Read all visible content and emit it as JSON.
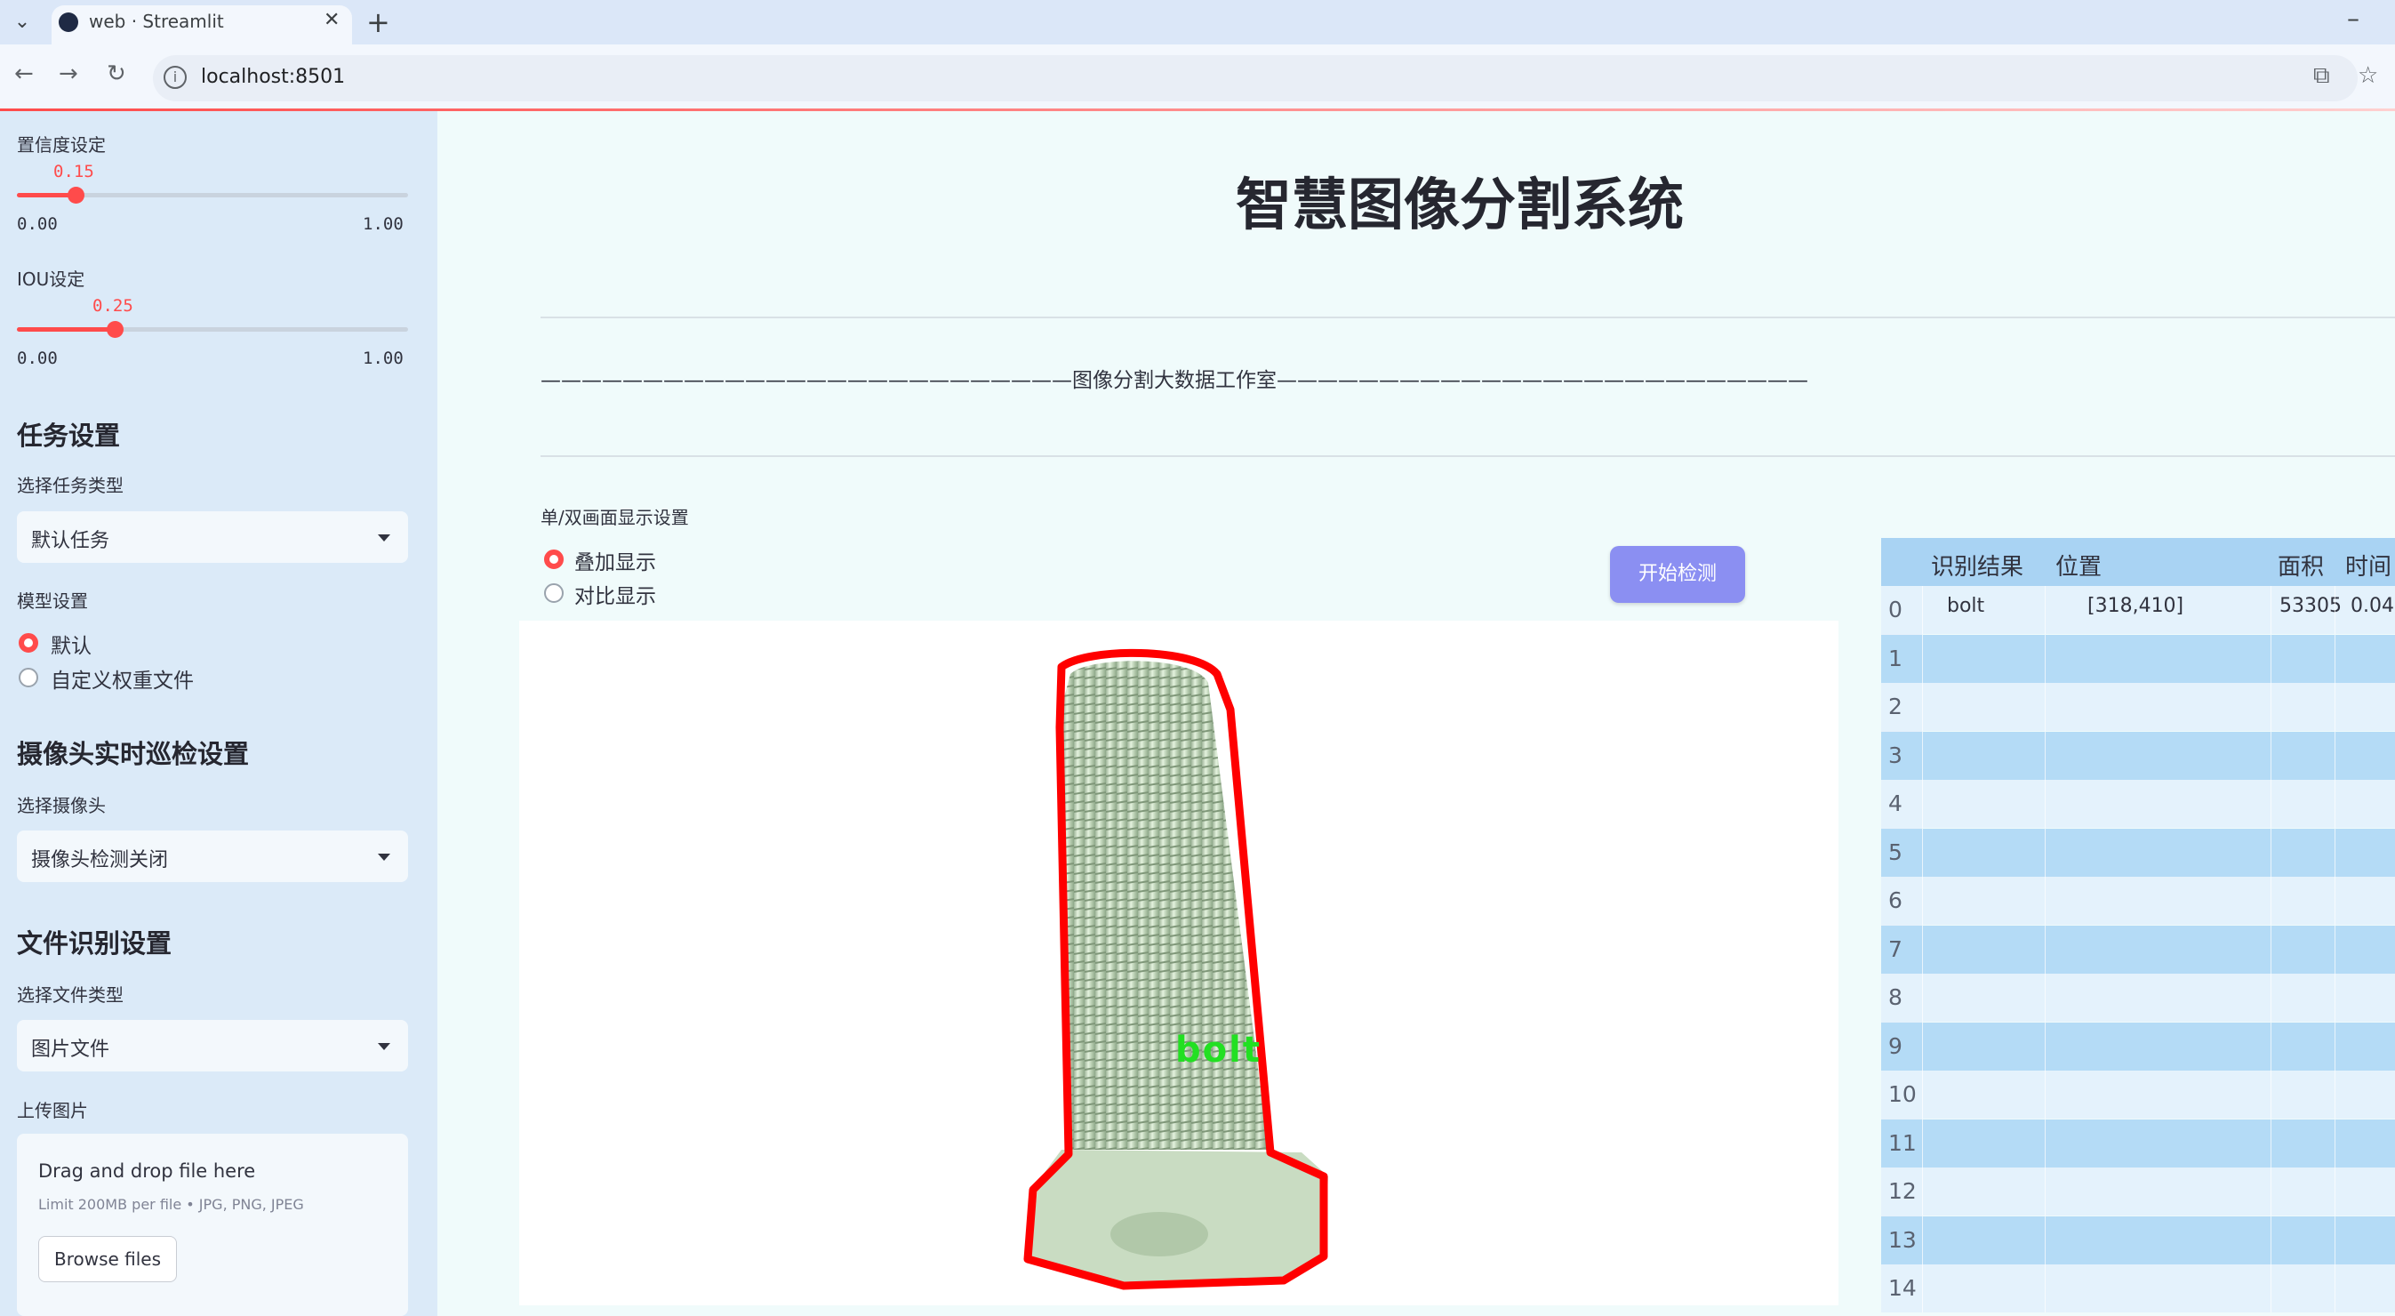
{
  "browser": {
    "tab_title": "web · Streamlit",
    "url": "localhost:8501"
  },
  "sidebar": {
    "confidence": {
      "label": "置信度设定",
      "value": "0.15",
      "min": "0.00",
      "max": "1.00",
      "fraction": 0.15
    },
    "iou": {
      "label": "IOU设定",
      "value": "0.25",
      "min": "0.00",
      "max": "1.00",
      "fraction": 0.25
    },
    "task_section": {
      "heading": "任务设置",
      "select_label": "选择任务类型",
      "selected": "默认任务"
    },
    "model_section": {
      "label": "模型设置",
      "options": [
        "默认",
        "自定义权重文件"
      ],
      "selected_index": 0
    },
    "camera_section": {
      "heading": "摄像头实时巡检设置",
      "select_label": "选择摄像头",
      "selected": "摄像头检测关闭"
    },
    "file_section": {
      "heading": "文件识别设置",
      "select_label": "选择文件类型",
      "selected": "图片文件",
      "upload_label": "上传图片"
    },
    "uploader": {
      "title": "Drag and drop file here",
      "limit": "Limit 200MB per file • JPG, PNG, JPEG",
      "button": "Browse files"
    }
  },
  "main": {
    "title": "智慧图像分割系统",
    "subtitle_line": "——————————————————————————图像分割大数据工作室——————————————————————————",
    "display_label": "单/双画面显示设置",
    "display_options": [
      "叠加显示",
      "对比显示"
    ],
    "display_selected_index": 0,
    "detect_button": "开始检测",
    "detection_label": "bolt"
  },
  "results_table": {
    "columns": [
      "识别结果",
      "位置",
      "面积",
      "时间"
    ],
    "rows": [
      {
        "index": "0",
        "result": "bolt",
        "position": "[318,410]",
        "area": "53305",
        "time": "0.04"
      },
      {
        "index": "1"
      },
      {
        "index": "2"
      },
      {
        "index": "3"
      },
      {
        "index": "4"
      },
      {
        "index": "5"
      },
      {
        "index": "6"
      },
      {
        "index": "7"
      },
      {
        "index": "8"
      },
      {
        "index": "9"
      },
      {
        "index": "10"
      },
      {
        "index": "11"
      },
      {
        "index": "12"
      },
      {
        "index": "13"
      },
      {
        "index": "14"
      }
    ]
  },
  "colors": {
    "accent": "#ff4b4b",
    "button": "#8b8ff2",
    "sidebar_bg": "#dbeaf8",
    "mask_outline": "#ff0000",
    "label_text": "#22e022"
  }
}
